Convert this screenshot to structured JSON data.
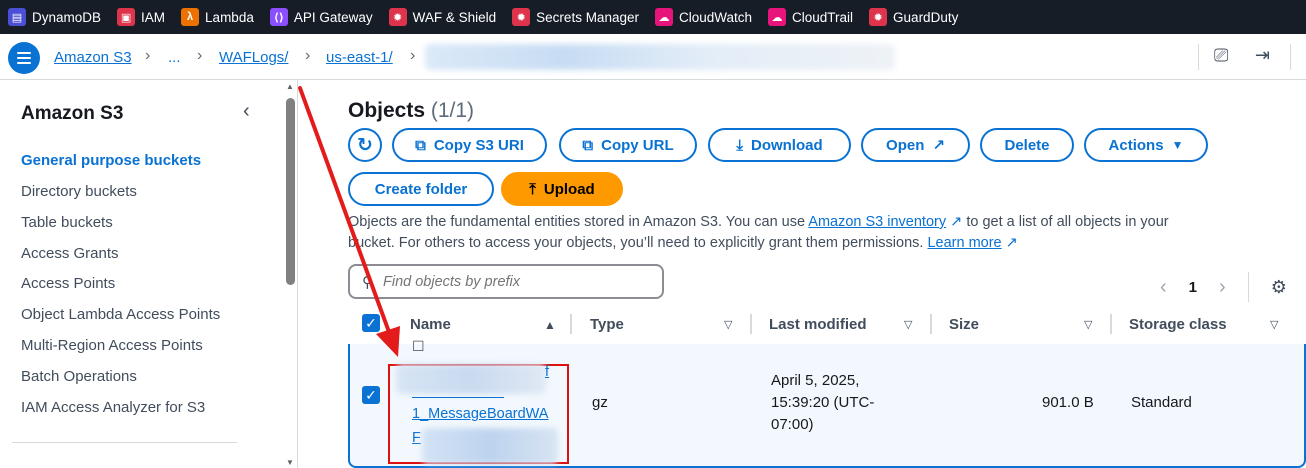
{
  "topbar": {
    "services": [
      {
        "label": "DynamoDB",
        "icon": "dynamodb-icon",
        "color": "#4b4fd6"
      },
      {
        "label": "IAM",
        "icon": "iam-icon",
        "color": "#dd344c"
      },
      {
        "label": "Lambda",
        "icon": "lambda-icon",
        "color": "#ed7100"
      },
      {
        "label": "API Gateway",
        "icon": "api-gateway-icon",
        "color": "#8c4fff"
      },
      {
        "label": "WAF & Shield",
        "icon": "waf-icon",
        "color": "#dd344c"
      },
      {
        "label": "Secrets Manager",
        "icon": "secrets-manager-icon",
        "color": "#dd344c"
      },
      {
        "label": "CloudWatch",
        "icon": "cloudwatch-icon",
        "color": "#e7157b"
      },
      {
        "label": "CloudTrail",
        "icon": "cloudtrail-icon",
        "color": "#e7157b"
      },
      {
        "label": "GuardDuty",
        "icon": "guardduty-icon",
        "color": "#dd344c"
      }
    ]
  },
  "breadcrumb": {
    "items": [
      "Amazon S3",
      "...",
      "WAFLogs/",
      "us-east-1/"
    ]
  },
  "sidebar": {
    "title": "Amazon S3",
    "items": [
      "General purpose buckets",
      "Directory buckets",
      "Table buckets",
      "Access Grants",
      "Access Points",
      "Object Lambda Access Points",
      "Multi-Region Access Points",
      "Batch Operations",
      "IAM Access Analyzer for S3"
    ],
    "active_index": 0
  },
  "objects": {
    "title": "Objects",
    "count": "(1/1)",
    "buttons": {
      "copy_uri": "Copy S3 URI",
      "copy_url": "Copy URL",
      "download": "Download",
      "open": "Open",
      "delete": "Delete",
      "actions": "Actions",
      "create_folder": "Create folder",
      "upload": "Upload"
    },
    "desc_line1_a": "Objects are the fundamental entities stored in Amazon S3. You can use",
    "desc_link1": "Amazon S3 inventory",
    "desc_line1_b": "to get a list of all objects in your",
    "desc_line2": "bucket. For others to access your objects, you’ll need to explicitly grant them permissions.",
    "desc_link2": "Learn more",
    "search_placeholder": "Find objects by prefix",
    "page": "1"
  },
  "table": {
    "columns": [
      "Name",
      "Type",
      "Last modified",
      "Size",
      "Storage class"
    ],
    "row": {
      "name_fragment_1": "f",
      "name_fragment_2": "1_MessageBoardWA",
      "name_fragment_3": "F",
      "type": "gz",
      "last_modified_1": "April 5, 2025,",
      "last_modified_2": "15:39:20 (UTC-",
      "last_modified_3": "07:00)",
      "size": "901.0 B",
      "storage_class": "Standard"
    }
  },
  "annotation_color": "#dd1111"
}
